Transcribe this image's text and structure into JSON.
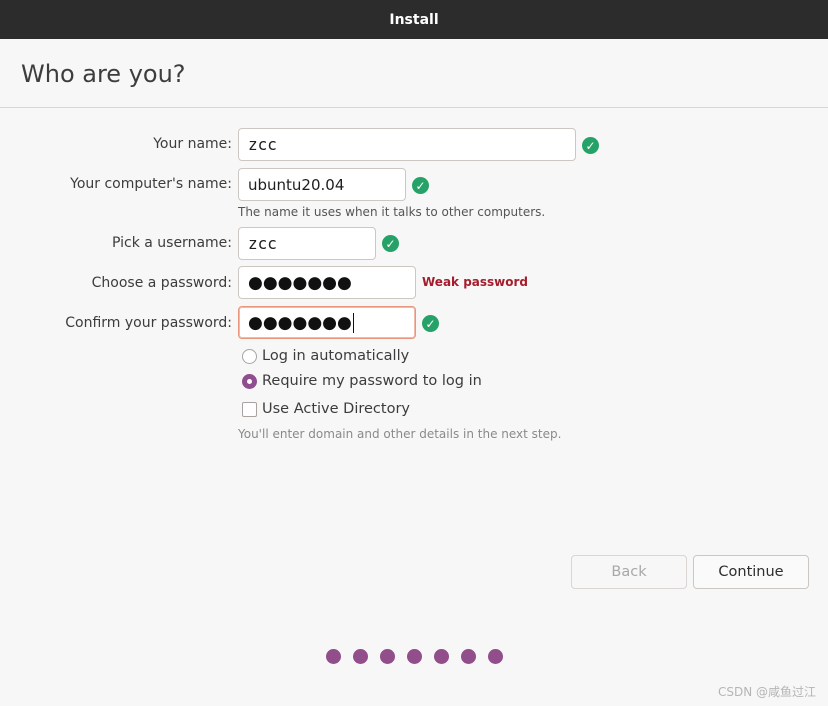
{
  "window": {
    "title": "Install"
  },
  "page": {
    "title": "Who are you?"
  },
  "form": {
    "name": {
      "label": "Your name:",
      "value": "zcc"
    },
    "computer": {
      "label": "Your computer's name:",
      "value": "ubuntu20.04",
      "hint": "The name it uses when it talks to other computers."
    },
    "username": {
      "label": "Pick a username:",
      "value": "zcc"
    },
    "password": {
      "label": "Choose a password:",
      "value": "●●●●●●●",
      "strength": "Weak password"
    },
    "confirm": {
      "label": "Confirm your password:",
      "value": "●●●●●●●"
    },
    "login_auto": {
      "label": "Log in automatically",
      "selected": false
    },
    "require_password": {
      "label": "Require my password to log in",
      "selected": true
    },
    "active_directory": {
      "label": "Use Active Directory",
      "checked": false,
      "hint": "You'll enter domain and other details in the next step."
    }
  },
  "buttons": {
    "back": "Back",
    "continue": "Continue"
  },
  "progress": {
    "total_steps": 7
  },
  "watermark": "CSDN @咸鱼过江",
  "colors": {
    "titlebar": "#2c2c2c",
    "accent": "#924d8b",
    "ok": "#26a269",
    "weak": "#a51d2d"
  }
}
